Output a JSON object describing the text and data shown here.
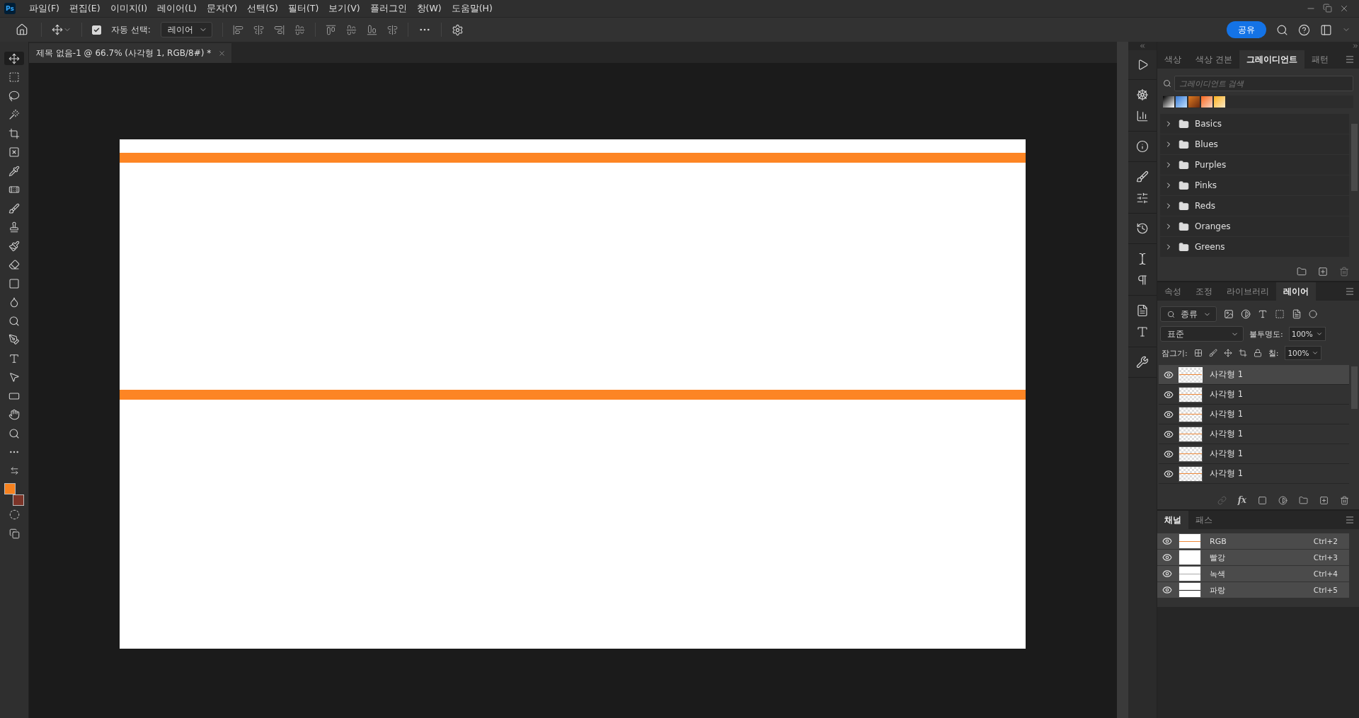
{
  "app": {
    "logo": "Ps"
  },
  "menu": [
    "파일(F)",
    "편집(E)",
    "이미지(I)",
    "레이어(L)",
    "문자(Y)",
    "선택(S)",
    "필터(T)",
    "보기(V)",
    "플러그인",
    "창(W)",
    "도움말(H)"
  ],
  "options_bar": {
    "auto_select": {
      "label": "자동 선택:",
      "checked": true
    },
    "target": "레이어",
    "share": "공유"
  },
  "document_tab": {
    "title": "제목 없음-1 @ 66.7% (사각형 1, RGB/8#) *"
  },
  "color_swatches": [
    {
      "kind": "foreground",
      "color": "#f7821f"
    },
    {
      "kind": "background",
      "color": "#7c3428"
    }
  ],
  "gradients_panel": {
    "tabs": [
      {
        "label": "색상",
        "selected": false
      },
      {
        "label": "색상 견본",
        "selected": false
      },
      {
        "label": "그레이디언트",
        "selected": true
      },
      {
        "label": "패턴",
        "selected": false
      }
    ],
    "search": {
      "placeholder": "그레이디언트 검색"
    },
    "folders": [
      {
        "name": "Basics",
        "expanded": false
      },
      {
        "name": "Blues",
        "expanded": false
      },
      {
        "name": "Purples",
        "expanded": false
      },
      {
        "name": "Pinks",
        "expanded": false
      },
      {
        "name": "Reds",
        "expanded": false
      },
      {
        "name": "Oranges",
        "expanded": false
      },
      {
        "name": "Greens",
        "expanded": false
      }
    ]
  },
  "layers_panel": {
    "tabs": [
      {
        "label": "속성",
        "selected": false
      },
      {
        "label": "조정",
        "selected": false
      },
      {
        "label": "라이브러리",
        "selected": false
      },
      {
        "label": "레이어",
        "selected": true
      }
    ],
    "filter": "종류",
    "blend_mode": "표준",
    "opacity_label": "불투명도:",
    "opacity": "100%",
    "lock_label": "잠그기:",
    "fill_label": "칠:",
    "fill": "100%",
    "fx_label": "fx",
    "layers": [
      {
        "name": "사각형 1",
        "visible": true,
        "selected": true
      },
      {
        "name": "사각형 1",
        "visible": true,
        "selected": false
      },
      {
        "name": "사각형 1",
        "visible": true,
        "selected": false
      },
      {
        "name": "사각형 1",
        "visible": true,
        "selected": false
      },
      {
        "name": "사각형 1",
        "visible": true,
        "selected": false
      },
      {
        "name": "사각형 1",
        "visible": true,
        "selected": false
      }
    ]
  },
  "channels_panel": {
    "tabs": [
      {
        "label": "채널",
        "selected": true
      },
      {
        "label": "패스",
        "selected": false
      }
    ],
    "channels": [
      {
        "name": "RGB",
        "shortcut": "Ctrl+2",
        "visible": true,
        "selected": true
      },
      {
        "name": "빨강",
        "shortcut": "Ctrl+3",
        "visible": true,
        "selected": true
      },
      {
        "name": "녹색",
        "shortcut": "Ctrl+4",
        "visible": true,
        "selected": true
      },
      {
        "name": "파랑",
        "shortcut": "Ctrl+5",
        "visible": true,
        "selected": true
      }
    ]
  }
}
